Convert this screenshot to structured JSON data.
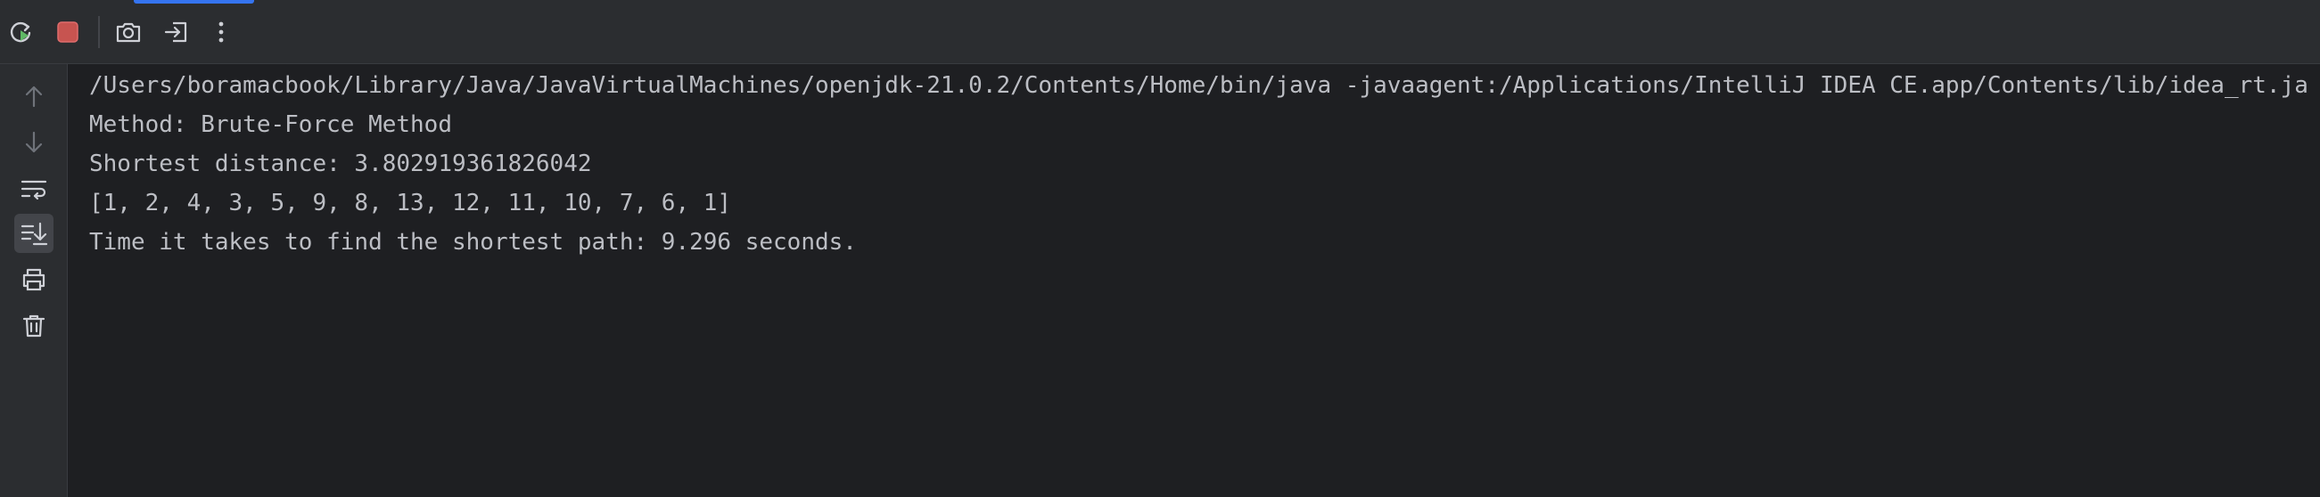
{
  "console": {
    "lines": [
      "/Users/boramacbook/Library/Java/JavaVirtualMachines/openjdk-21.0.2/Contents/Home/bin/java -javaagent:/Applications/IntelliJ IDEA CE.app/Contents/lib/idea_rt.ja",
      "Method: Brute-Force Method",
      "Shortest distance: 3.802919361826042",
      "[1, 2, 4, 3, 5, 9, 8, 13, 12, 11, 10, 7, 6, 1]",
      "Time it takes to find the shortest path: 9.296 seconds."
    ]
  },
  "toolbar": {
    "icons": [
      "rerun-icon",
      "stop-icon",
      "camera-icon",
      "exit-icon",
      "more-vertical-icon"
    ],
    "colors": {
      "rerun": "#5fb865",
      "stop": "#db5c5c",
      "icon": "#ced0d6"
    }
  },
  "gutter": {
    "icons": [
      "arrow-up-icon",
      "arrow-down-icon",
      "soft-wrap-icon",
      "scroll-to-end-icon",
      "print-icon",
      "trash-icon"
    ]
  },
  "theme": {
    "background": "#1e1f22",
    "panel": "#2b2d30",
    "text": "#bcbec4",
    "accent": "#3574f0"
  }
}
